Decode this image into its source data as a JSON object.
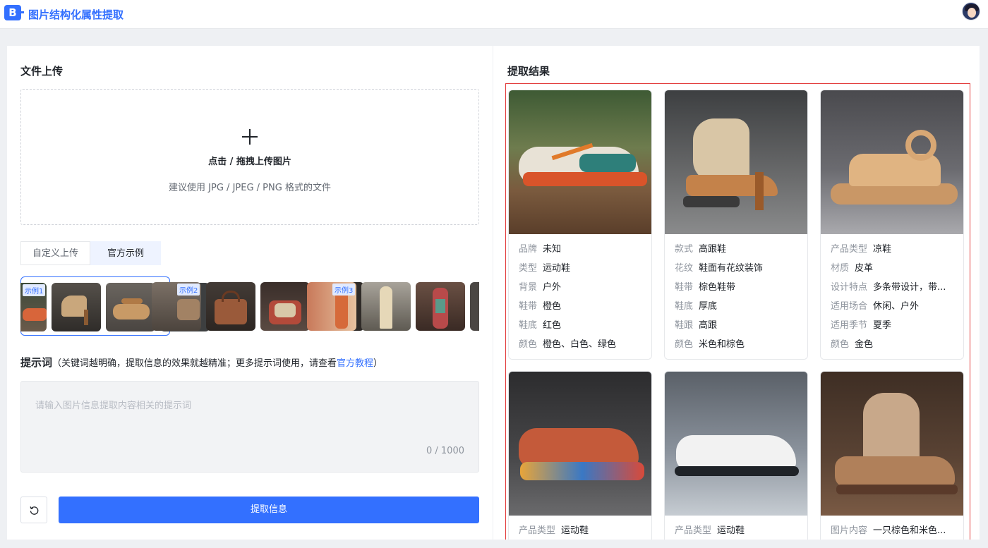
{
  "app": {
    "title": "图片结构化属性提取",
    "logo_text": "B"
  },
  "upload": {
    "section_title": "文件上传",
    "drop_title": "点击 / 拖拽上传图片",
    "drop_hint": "建议使用 JPG / JPEG / PNG 格式的文件"
  },
  "tabs": [
    {
      "label": "自定义上传"
    },
    {
      "label": "官方示例"
    }
  ],
  "examples": [
    {
      "badge": "示例1"
    },
    {
      "badge": "示例2"
    },
    {
      "badge": "示例3"
    }
  ],
  "prompt": {
    "label": "提示词",
    "hint_prefix": "（关键词越明确，提取信息的效果就越精准；更多提示词使用，请查看",
    "link": "官方教程",
    "hint_suffix": "）",
    "placeholder": "请输入图片信息提取内容相关的提示词",
    "counter": "0 / 1000"
  },
  "actions": {
    "extract_label": "提取信息"
  },
  "results": {
    "section_title": "提取结果",
    "cards": [
      {
        "attrs": [
          {
            "k": "品牌",
            "v": "未知"
          },
          {
            "k": "类型",
            "v": "运动鞋"
          },
          {
            "k": "背景",
            "v": "户外"
          },
          {
            "k": "鞋带",
            "v": "橙色"
          },
          {
            "k": "鞋底",
            "v": "红色"
          },
          {
            "k": "颜色",
            "v": "橙色、白色、绿色"
          }
        ]
      },
      {
        "attrs": [
          {
            "k": "款式",
            "v": "高跟鞋"
          },
          {
            "k": "花纹",
            "v": "鞋面有花纹装饰"
          },
          {
            "k": "鞋带",
            "v": "棕色鞋带"
          },
          {
            "k": "鞋底",
            "v": "厚底"
          },
          {
            "k": "鞋跟",
            "v": "高跟"
          },
          {
            "k": "颜色",
            "v": "米色和棕色"
          }
        ]
      },
      {
        "attrs": [
          {
            "k": "产品类型",
            "v": "凉鞋"
          },
          {
            "k": "材质",
            "v": "皮革"
          },
          {
            "k": "设计特点",
            "v": "多条带设计，带..."
          },
          {
            "k": "适用场合",
            "v": "休闲、户外"
          },
          {
            "k": "适用季节",
            "v": "夏季"
          },
          {
            "k": "颜色",
            "v": "金色"
          }
        ]
      },
      {
        "attrs": [
          {
            "k": "产品类型",
            "v": "运动鞋"
          }
        ]
      },
      {
        "attrs": [
          {
            "k": "产品类型",
            "v": "运动鞋"
          }
        ]
      },
      {
        "attrs": [
          {
            "k": "图片内容",
            "v": "一只棕色和米色..."
          }
        ]
      }
    ]
  },
  "colors": {
    "accent": "#3370ff",
    "highlight_border": "#e23b3b"
  }
}
